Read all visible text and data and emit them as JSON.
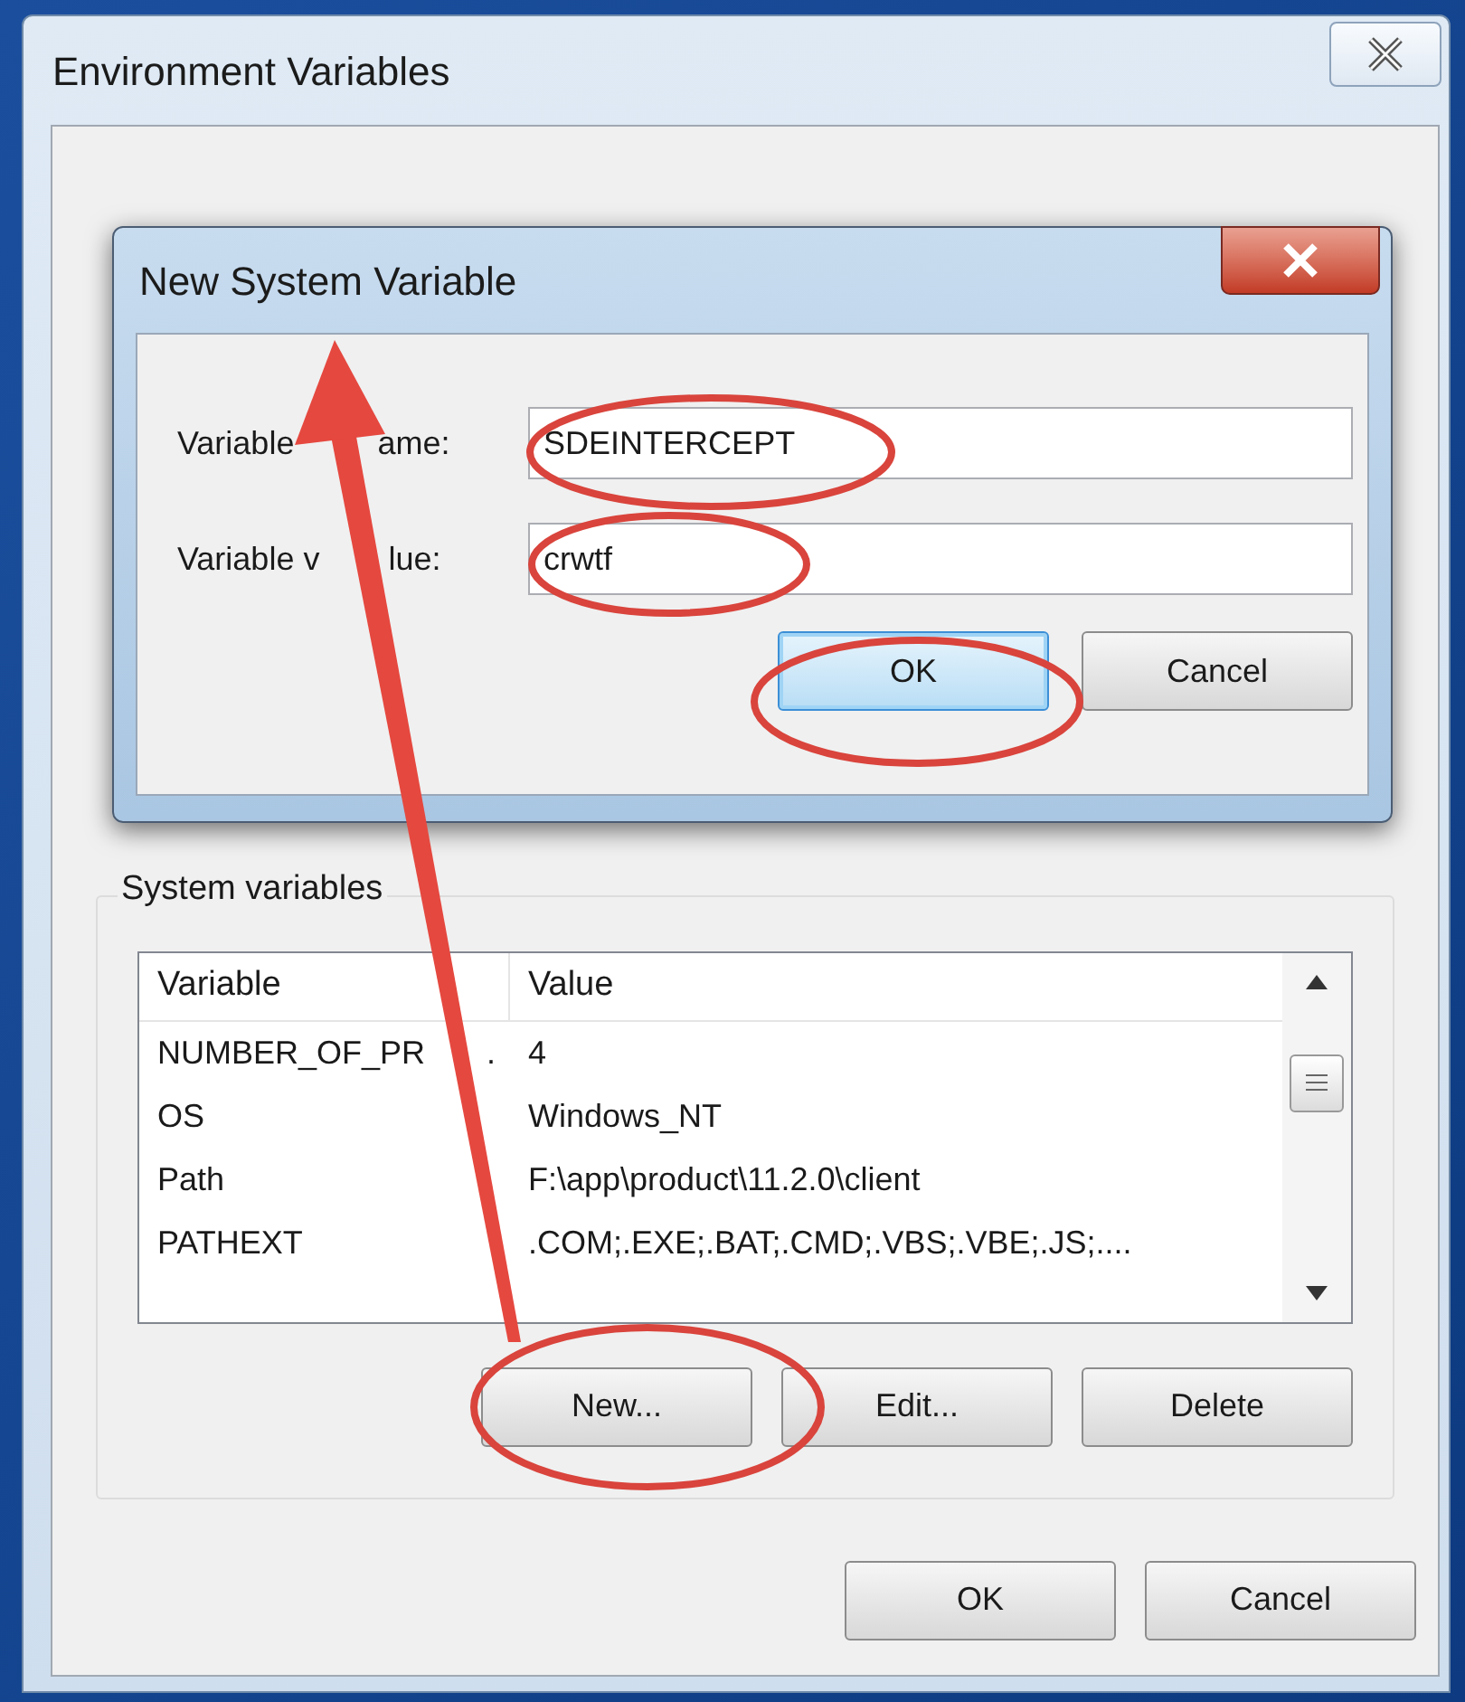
{
  "window": {
    "title": "Environment Variables"
  },
  "dialog": {
    "title": "New System Variable",
    "fields": [
      {
        "label": [
          "Variable",
          "ame:"
        ],
        "value": "SDEINTERCEPT"
      },
      {
        "label": [
          "Variable v",
          "lue:"
        ],
        "value": "crwtf"
      }
    ],
    "buttons": [
      {
        "label": "OK",
        "selected": true
      },
      {
        "label": "Cancel",
        "selected": false
      }
    ]
  },
  "system_variables": {
    "title": "System variables",
    "columns": [
      "Variable",
      "Value"
    ],
    "rows": [
      [
        [
          "NUMBER_OF_PR",
          "."
        ],
        "4"
      ],
      [
        "OS",
        "Windows_NT"
      ],
      [
        "Path",
        "F:\\app\\product\\11.2.0\\client"
      ],
      [
        "PATHEXT",
        ".COM;.EXE;.BAT;.CMD;.VBS;.VBE;.JS;...."
      ]
    ],
    "buttons": [
      "New...",
      "Edit...",
      "Delete"
    ]
  },
  "buttons": [
    "OK",
    "Cancel"
  ]
}
